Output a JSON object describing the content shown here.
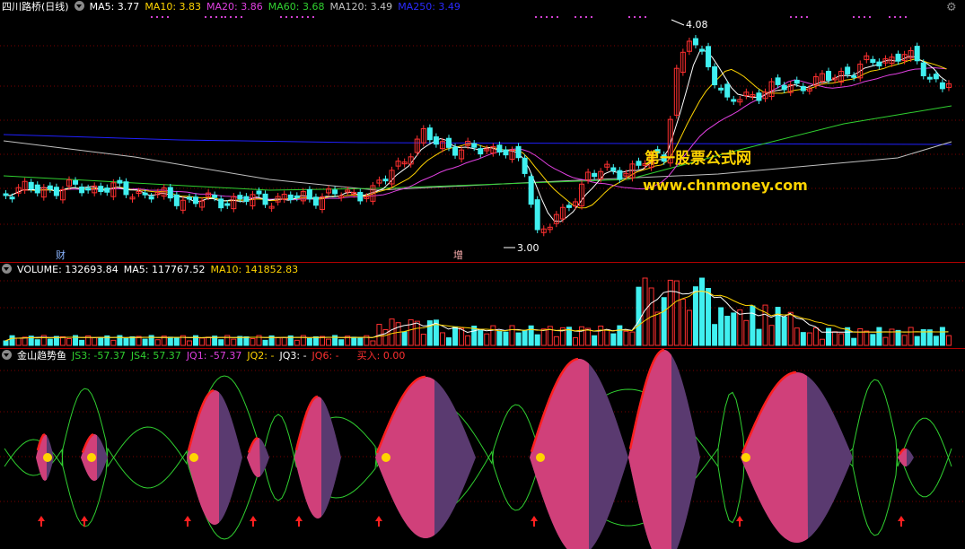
{
  "price_panel": {
    "stock_name": "四川路桥(日线)",
    "indicators": [
      {
        "label": "MA5: 3.77",
        "color": "#ffffff"
      },
      {
        "label": "MA10: 3.83",
        "color": "#ffd400"
      },
      {
        "label": "MA20: 3.86",
        "color": "#e040e0"
      },
      {
        "label": "MA60: 3.68",
        "color": "#30d030"
      },
      {
        "label": "MA120: 3.49",
        "color": "#c0c0c0"
      },
      {
        "label": "MA250: 3.49",
        "color": "#2020ff"
      }
    ],
    "high_label": "4.08",
    "low_label": "3.00",
    "event_marks": [
      "财",
      "增"
    ],
    "watermark_title": "第一股票公式网",
    "watermark_url": "www.chnmoney.com"
  },
  "volume_panel": {
    "indicators": [
      {
        "label": "VOLUME: 132693.84",
        "color": "#ffffff"
      },
      {
        "label": "MA5: 117767.52",
        "color": "#ffffff"
      },
      {
        "label": "MA10: 141852.83",
        "color": "#ffd400"
      }
    ]
  },
  "indicator_panel": {
    "name": "金山趋势鱼",
    "indicators": [
      {
        "label": "JS3: -57.37",
        "color": "#30d030"
      },
      {
        "label": "JS4: 57.37",
        "color": "#30d030"
      },
      {
        "label": "JQ1: -57.37",
        "color": "#e040e0"
      },
      {
        "label": "JQ2: -",
        "color": "#ffd400"
      },
      {
        "label": "JQ3: -",
        "color": "#ffffff"
      },
      {
        "label": "JQ6: -",
        "color": "#ff3030"
      },
      {
        "label": "买入: 0.00",
        "color": "#ff3030"
      }
    ]
  },
  "colors": {
    "up": "#ff3030",
    "down": "#40f0f0",
    "fish_pink": "#d0407a",
    "fish_purple": "#5a3a70",
    "buy_arrow": "#ff2020",
    "buy_dot": "#ffd400"
  }
}
